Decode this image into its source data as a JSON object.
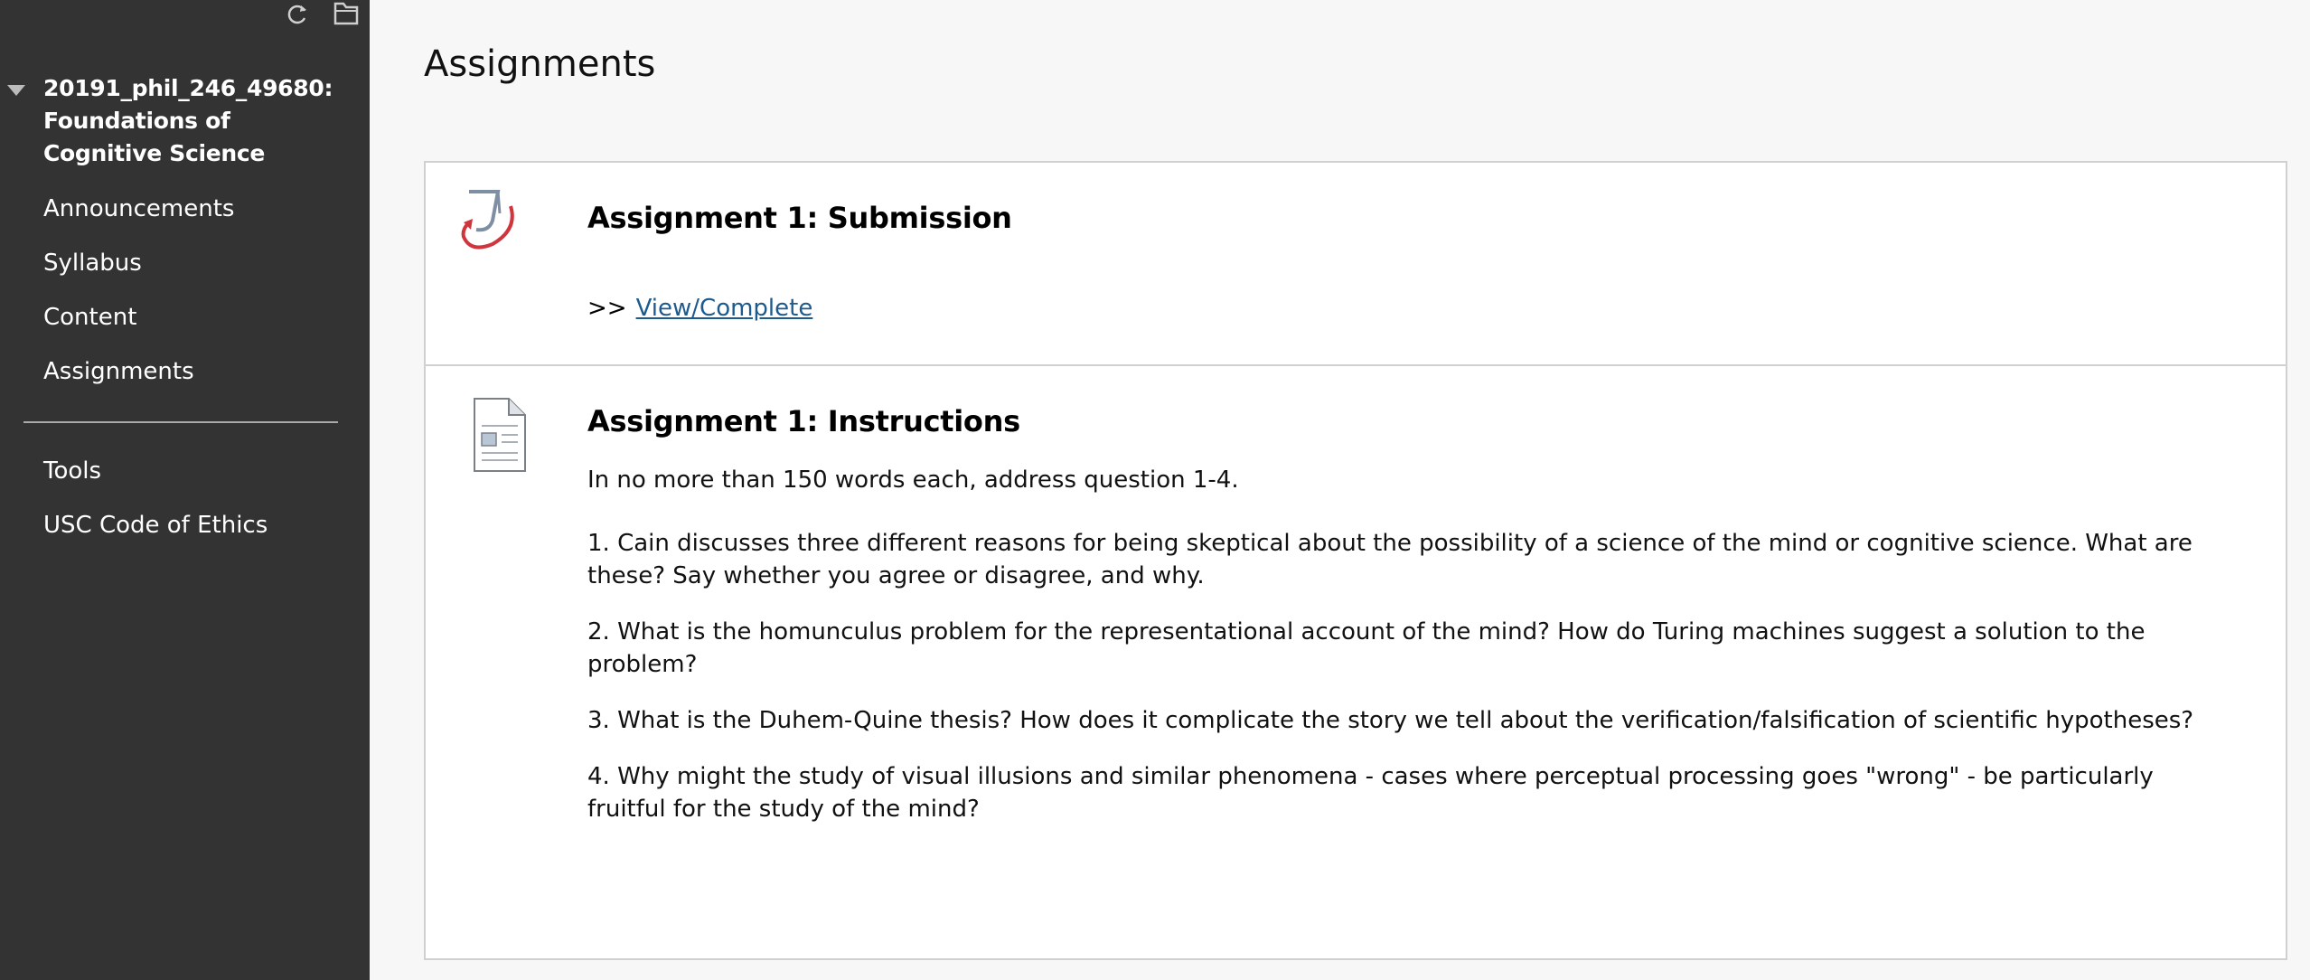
{
  "sidebar": {
    "icons": [
      "refresh-icon",
      "folder-icon"
    ],
    "course_title": "20191_phil_246_49680: Foundations of Cognitive Science",
    "items": [
      {
        "label": "Announcements"
      },
      {
        "label": "Syllabus"
      },
      {
        "label": "Content"
      },
      {
        "label": "Assignments"
      }
    ],
    "items2": [
      {
        "label": "Tools"
      },
      {
        "label": "USC Code of Ethics"
      }
    ]
  },
  "main": {
    "page_title": "Assignments",
    "assignments": [
      {
        "title": "Assignment 1: Submission",
        "prefix": ">>",
        "link_label": "View/Complete",
        "icon": "turnitin-icon"
      },
      {
        "title": "Assignment 1: Instructions",
        "icon": "document-icon",
        "intro": "In no more than 150 words each, address question 1-4.",
        "questions": [
          "1. Cain discusses three different reasons for being skeptical about the possibility of a science of the mind or cognitive science. What are these? Say whether you agree or disagree, and why.",
          "2. What is the homunculus problem for the representational account of the mind? How do Turing machines suggest a solution to the problem?",
          "3. What is the Duhem-Quine thesis? How does it complicate the story we tell about the verification/falsification of scientific hypotheses?",
          "4. Why might the study of visual illusions and similar phenomena - cases where perceptual processing goes \"wrong\" - be particularly fruitful for the study of the mind?"
        ]
      }
    ]
  },
  "colors": {
    "sidebar_bg": "#333333",
    "link": "#1d5a8e",
    "turnitin_red": "#d0343c"
  }
}
